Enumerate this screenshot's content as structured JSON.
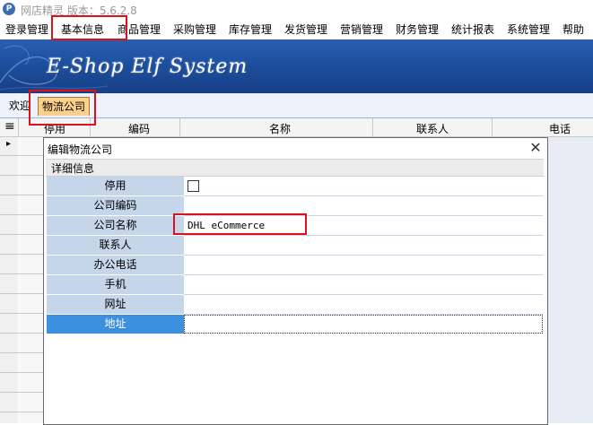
{
  "window": {
    "icon_letter": "P",
    "title": "网店精灵  版本：5.6.2.8"
  },
  "menubar": {
    "items": [
      "登录管理",
      "基本信息",
      "商品管理",
      "采购管理",
      "库存管理",
      "发货管理",
      "营销管理",
      "财务管理",
      "统计报表",
      "系统管理",
      "帮助"
    ]
  },
  "banner": {
    "logo_text": "E-Shop Elf System"
  },
  "tabs": [
    {
      "label": "欢迎",
      "active": false
    },
    {
      "label": "物流公司",
      "active": true
    }
  ],
  "grid": {
    "menu_glyph": "≡",
    "row_marker": "▸",
    "columns": [
      "停用",
      "编码",
      "名称",
      "联系人",
      "电话"
    ]
  },
  "dialog": {
    "title": "编辑物流公司",
    "close_glyph": "✕",
    "section_title": "详细信息",
    "fields": [
      {
        "label": "停用",
        "value": "",
        "type": "checkbox",
        "checked": false
      },
      {
        "label": "公司编码",
        "value": ""
      },
      {
        "label": "公司名称",
        "value": "DHL eCommerce"
      },
      {
        "label": "联系人",
        "value": ""
      },
      {
        "label": "办公电话",
        "value": ""
      },
      {
        "label": "手机",
        "value": ""
      },
      {
        "label": "网址",
        "value": ""
      },
      {
        "label": "地址",
        "value": "",
        "selected": true
      }
    ]
  },
  "colors": {
    "banner": "#1d4f9e",
    "active_tab": "#fbd08a",
    "prop_label_bg": "#c5d5ea",
    "prop_selected": "#3d8fe0",
    "highlight": "#e0101a"
  }
}
